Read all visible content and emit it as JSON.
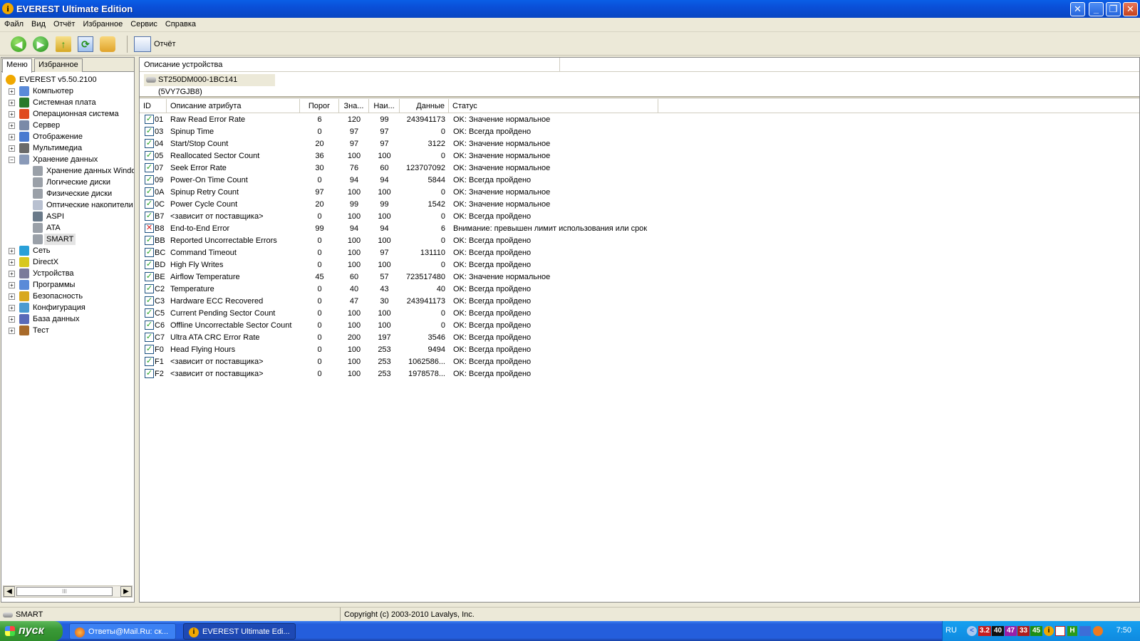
{
  "window": {
    "title": "EVEREST Ultimate Edition"
  },
  "menu": [
    "Файл",
    "Вид",
    "Отчёт",
    "Избранное",
    "Сервис",
    "Справка"
  ],
  "toolbar": {
    "report_label": "Отчёт"
  },
  "left_tabs": [
    "Меню",
    "Избранное"
  ],
  "tree": [
    {
      "label": "EVEREST v5.50.2100",
      "level": 0,
      "expander": "",
      "icon": "info-icon"
    },
    {
      "label": "Компьютер",
      "level": 0,
      "expander": "+",
      "icon": "computer-icon"
    },
    {
      "label": "Системная плата",
      "level": 0,
      "expander": "+",
      "icon": "motherboard-icon"
    },
    {
      "label": "Операционная система",
      "level": 0,
      "expander": "+",
      "icon": "windows-icon"
    },
    {
      "label": "Сервер",
      "level": 0,
      "expander": "+",
      "icon": "server-icon"
    },
    {
      "label": "Отображение",
      "level": 0,
      "expander": "+",
      "icon": "display-icon"
    },
    {
      "label": "Мультимедиа",
      "level": 0,
      "expander": "+",
      "icon": "multimedia-icon"
    },
    {
      "label": "Хранение данных",
      "level": 0,
      "expander": "−",
      "icon": "storage-icon"
    },
    {
      "label": "Хранение данных Windo",
      "level": 1,
      "expander": "",
      "icon": "drive-icon"
    },
    {
      "label": "Логические диски",
      "level": 1,
      "expander": "",
      "icon": "drive-icon"
    },
    {
      "label": "Физические диски",
      "level": 1,
      "expander": "",
      "icon": "drive-icon"
    },
    {
      "label": "Оптические накопители",
      "level": 1,
      "expander": "",
      "icon": "optical-icon"
    },
    {
      "label": "ASPI",
      "level": 1,
      "expander": "",
      "icon": "aspi-icon"
    },
    {
      "label": "ATA",
      "level": 1,
      "expander": "",
      "icon": "drive-icon"
    },
    {
      "label": "SMART",
      "level": 1,
      "expander": "",
      "icon": "drive-icon",
      "selected": true
    },
    {
      "label": "Сеть",
      "level": 0,
      "expander": "+",
      "icon": "network-icon"
    },
    {
      "label": "DirectX",
      "level": 0,
      "expander": "+",
      "icon": "directx-icon"
    },
    {
      "label": "Устройства",
      "level": 0,
      "expander": "+",
      "icon": "devices-icon"
    },
    {
      "label": "Программы",
      "level": 0,
      "expander": "+",
      "icon": "programs-icon"
    },
    {
      "label": "Безопасность",
      "level": 0,
      "expander": "+",
      "icon": "security-icon"
    },
    {
      "label": "Конфигурация",
      "level": 0,
      "expander": "+",
      "icon": "config-icon"
    },
    {
      "label": "База данных",
      "level": 0,
      "expander": "+",
      "icon": "database-icon"
    },
    {
      "label": "Тест",
      "level": 0,
      "expander": "+",
      "icon": "test-icon"
    }
  ],
  "scroll_thumb_label": "III",
  "device": {
    "header": "Описание устройства",
    "name": "ST250DM000-1BC141 (5VY7GJB8)"
  },
  "columns": [
    "ID",
    "Описание атрибута",
    "Порог",
    "Зна...",
    "Наи...",
    "Данные",
    "Статус"
  ],
  "rows": [
    {
      "id": "01",
      "desc": "Raw Read Error Rate",
      "thr": "6",
      "val": "120",
      "worst": "99",
      "data": "243941173",
      "status": "OK: Значение нормальное",
      "ok": true
    },
    {
      "id": "03",
      "desc": "Spinup Time",
      "thr": "0",
      "val": "97",
      "worst": "97",
      "data": "0",
      "status": "OK: Всегда пройдено",
      "ok": true
    },
    {
      "id": "04",
      "desc": "Start/Stop Count",
      "thr": "20",
      "val": "97",
      "worst": "97",
      "data": "3122",
      "status": "OK: Значение нормальное",
      "ok": true
    },
    {
      "id": "05",
      "desc": "Reallocated Sector Count",
      "thr": "36",
      "val": "100",
      "worst": "100",
      "data": "0",
      "status": "OK: Значение нормальное",
      "ok": true
    },
    {
      "id": "07",
      "desc": "Seek Error Rate",
      "thr": "30",
      "val": "76",
      "worst": "60",
      "data": "123707092",
      "status": "OK: Значение нормальное",
      "ok": true
    },
    {
      "id": "09",
      "desc": "Power-On Time Count",
      "thr": "0",
      "val": "94",
      "worst": "94",
      "data": "5844",
      "status": "OK: Всегда пройдено",
      "ok": true
    },
    {
      "id": "0A",
      "desc": "Spinup Retry Count",
      "thr": "97",
      "val": "100",
      "worst": "100",
      "data": "0",
      "status": "OK: Значение нормальное",
      "ok": true
    },
    {
      "id": "0C",
      "desc": "Power Cycle Count",
      "thr": "20",
      "val": "99",
      "worst": "99",
      "data": "1542",
      "status": "OK: Значение нормальное",
      "ok": true
    },
    {
      "id": "B7",
      "desc": "<зависит от поставщика>",
      "thr": "0",
      "val": "100",
      "worst": "100",
      "data": "0",
      "status": "OK: Всегда пройдено",
      "ok": true
    },
    {
      "id": "B8",
      "desc": "End-to-End Error",
      "thr": "99",
      "val": "94",
      "worst": "94",
      "data": "6",
      "status": "Внимание: превышен лимит использования или срок",
      "ok": false
    },
    {
      "id": "BB",
      "desc": "Reported Uncorrectable Errors",
      "thr": "0",
      "val": "100",
      "worst": "100",
      "data": "0",
      "status": "OK: Всегда пройдено",
      "ok": true
    },
    {
      "id": "BC",
      "desc": "Command Timeout",
      "thr": "0",
      "val": "100",
      "worst": "97",
      "data": "131110",
      "status": "OK: Всегда пройдено",
      "ok": true
    },
    {
      "id": "BD",
      "desc": "High Fly Writes",
      "thr": "0",
      "val": "100",
      "worst": "100",
      "data": "0",
      "status": "OK: Всегда пройдено",
      "ok": true
    },
    {
      "id": "BE",
      "desc": "Airflow Temperature",
      "thr": "45",
      "val": "60",
      "worst": "57",
      "data": "723517480",
      "status": "OK: Значение нормальное",
      "ok": true
    },
    {
      "id": "C2",
      "desc": "Temperature",
      "thr": "0",
      "val": "40",
      "worst": "43",
      "data": "40",
      "status": "OK: Всегда пройдено",
      "ok": true
    },
    {
      "id": "C3",
      "desc": "Hardware ECC Recovered",
      "thr": "0",
      "val": "47",
      "worst": "30",
      "data": "243941173",
      "status": "OK: Всегда пройдено",
      "ok": true
    },
    {
      "id": "C5",
      "desc": "Current Pending Sector Count",
      "thr": "0",
      "val": "100",
      "worst": "100",
      "data": "0",
      "status": "OK: Всегда пройдено",
      "ok": true
    },
    {
      "id": "C6",
      "desc": "Offline Uncorrectable Sector Count",
      "thr": "0",
      "val": "100",
      "worst": "100",
      "data": "0",
      "status": "OK: Всегда пройдено",
      "ok": true
    },
    {
      "id": "C7",
      "desc": "Ultra ATA CRC Error Rate",
      "thr": "0",
      "val": "200",
      "worst": "197",
      "data": "3546",
      "status": "OK: Всегда пройдено",
      "ok": true
    },
    {
      "id": "F0",
      "desc": "Head Flying Hours",
      "thr": "0",
      "val": "100",
      "worst": "253",
      "data": "9494",
      "status": "OK: Всегда пройдено",
      "ok": true
    },
    {
      "id": "F1",
      "desc": "<зависит от поставщика>",
      "thr": "0",
      "val": "100",
      "worst": "253",
      "data": "1062586...",
      "status": "OK: Всегда пройдено",
      "ok": true
    },
    {
      "id": "F2",
      "desc": "<зависит от поставщика>",
      "thr": "0",
      "val": "100",
      "worst": "253",
      "data": "1978578...",
      "status": "OK: Всегда пройдено",
      "ok": true
    }
  ],
  "statusbar": {
    "left": "SMART",
    "right": "Copyright (c) 2003-2010 Lavalys, Inc."
  },
  "taskbar": {
    "start": "пуск",
    "tasks": [
      "Ответы@Mail.Ru: ск...",
      "EVEREST Ultimate Edi..."
    ],
    "lang": "RU",
    "tray_numbers": [
      "3.2",
      "40",
      "47",
      "33",
      "45"
    ],
    "clock": "7:50"
  }
}
